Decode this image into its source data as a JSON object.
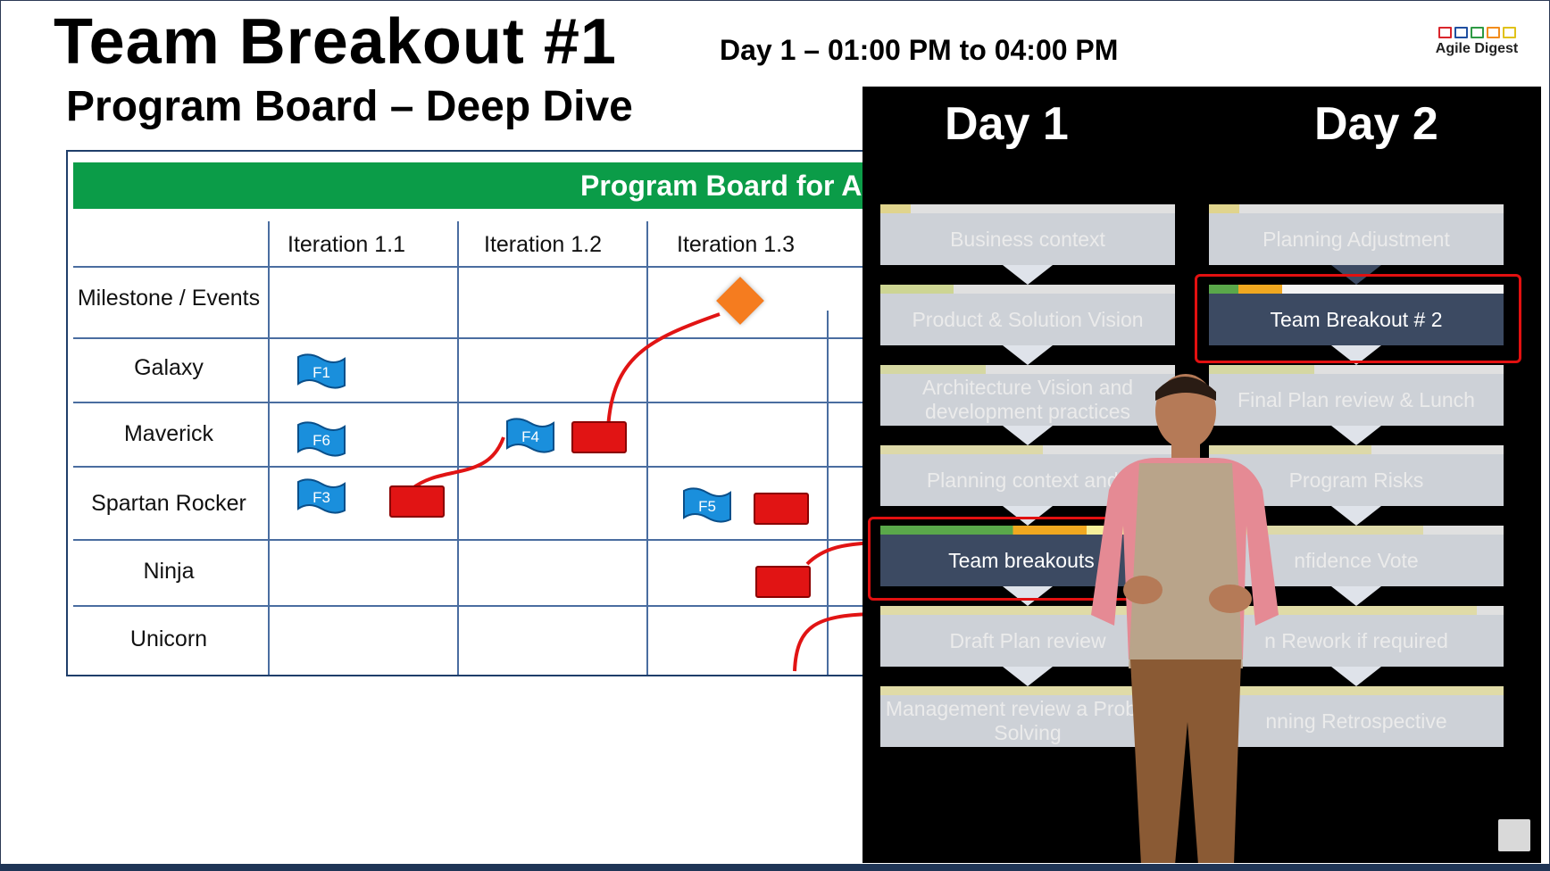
{
  "slide": {
    "title": "Team Breakout #1",
    "time": "Day 1 – 01:00 PM to 04:00 PM",
    "subtitle": "Program Board – Deep Dive"
  },
  "logo": {
    "name": "Agile Digest",
    "colors": [
      "#d9262c",
      "#1f4fa0",
      "#2e9a44",
      "#f28c1c",
      "#e0c21a"
    ]
  },
  "board": {
    "title": "Program Board for AR",
    "columns": [
      "Iteration 1.1",
      "Iteration 1.2",
      "Iteration 1.3"
    ],
    "rows": [
      "Milestone / Events",
      "Galaxy",
      "Maverick",
      "Spartan Rocker",
      "Ninja",
      "Unicorn"
    ],
    "features": [
      "F1",
      "F6",
      "F4",
      "F3",
      "F5"
    ],
    "colors": {
      "header": "#0b9c48",
      "flag": "#1a8fdc",
      "dependency": "#e11414",
      "milestone": "#f57c1f"
    }
  },
  "agenda": {
    "day1_title": "Day 1",
    "day2_title": "Day 2",
    "day1": [
      "Business context",
      "Product & Solution  Vision",
      "Architecture Vision and development practices",
      "Planning context and l",
      "Team breakouts (",
      "Draft Plan review",
      "Management review a Problem Solving"
    ],
    "day2": [
      "Planning Adjustment",
      "Team Breakout # 2",
      "Final Plan review & Lunch",
      "Program Risks",
      "nfidence Vote",
      "n Rework if required",
      "nning Retrospective"
    ]
  }
}
